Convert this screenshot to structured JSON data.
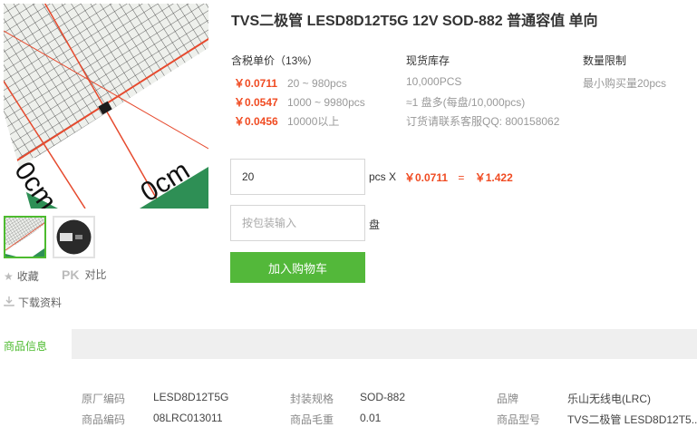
{
  "product": {
    "title": "TVS二极管 LESD8D12T5G 12V SOD-882 普通容值 单向"
  },
  "gallery": {
    "main_image_texts": [
      "0cm",
      "0cm"
    ],
    "thumbnail_count": 2
  },
  "actions": {
    "favorite_label": "收藏",
    "pk_label": "PK",
    "compare_label": "对比",
    "download_label": "下载资料"
  },
  "pricing": {
    "header": "含税单价（13%）",
    "tiers": [
      {
        "price": "￥0.0711",
        "range": "20 ~ 980pcs"
      },
      {
        "price": "￥0.0547",
        "range": "1000 ~ 9980pcs"
      },
      {
        "price": "￥0.0456",
        "range": "10000以上"
      }
    ]
  },
  "stock": {
    "header": "现货库存",
    "lines": [
      "10,000PCS",
      "≈1 盘多(每盘/10,000pcs)",
      "订货请联系客服QQ: 800158062"
    ]
  },
  "limit": {
    "header": "数量限制",
    "text": "最小购买量20pcs"
  },
  "order": {
    "quantity_value": "20",
    "quantity_unit": "pcs X",
    "unit_price": "￥0.0711",
    "equals": "=",
    "total": "￥1.422",
    "package_placeholder": "按包装输入",
    "package_unit": "盘",
    "cart_button": "加入购物车"
  },
  "tabs": {
    "active": "商品信息"
  },
  "specs": {
    "row1": [
      {
        "key": "原厂编码",
        "value": "LESD8D12T5G"
      },
      {
        "key": "封装规格",
        "value": "SOD-882"
      },
      {
        "key": "品牌",
        "value": "乐山无线电(LRC)"
      }
    ],
    "row2": [
      {
        "key": "商品编码",
        "value": "08LRC013011"
      },
      {
        "key": "商品毛重",
        "value": "0.01"
      },
      {
        "key": "商品型号",
        "value": "TVS二极管 LESD8D12T5..."
      }
    ]
  },
  "colors": {
    "accent_green": "#53b83a",
    "price_red": "#f04b22"
  }
}
